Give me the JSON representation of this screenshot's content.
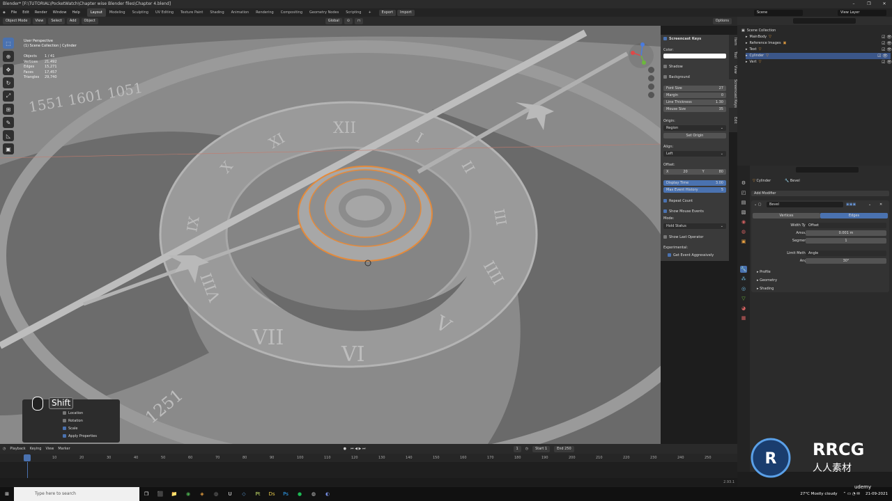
{
  "window": {
    "title": "Blender* [F:\\TUTORIAL\\PocketWatch\\Chapter wise Blender files\\Chapter 4.blend]",
    "controls": [
      "–",
      "❐",
      "✕"
    ]
  },
  "menubar": {
    "menus": [
      "File",
      "Edit",
      "Render",
      "Window",
      "Help"
    ],
    "workspaces": [
      "Layout",
      "Modeling",
      "Sculpting",
      "UV Editing",
      "Texture Paint",
      "Shading",
      "Animation",
      "Rendering",
      "Compositing",
      "Geometry Nodes",
      "Scripting"
    ],
    "active_workspace": "Layout",
    "export_label": "Export",
    "import_label": "Import",
    "scene": "Scene",
    "view_layer": "View Layer"
  },
  "viewport_header": {
    "mode": "Object Mode",
    "menus": [
      "View",
      "Select",
      "Add",
      "Object"
    ],
    "transform_orientation": "Global",
    "options_label": "Options"
  },
  "viewport": {
    "perspective": "User Perspective",
    "collection_info": "(1) Scene Collection | Cylinder",
    "stats": [
      {
        "label": "Objects",
        "value": "1 / 41"
      },
      {
        "label": "Vertices",
        "value": "21,492"
      },
      {
        "label": "Edges",
        "value": "15,271"
      },
      {
        "label": "Faces",
        "value": "17,457"
      },
      {
        "label": "Triangles",
        "value": "29,740"
      }
    ],
    "numerals": [
      "XII",
      "XI",
      "X",
      "IX",
      "VIII",
      "VII",
      "VI",
      "V",
      "IIII",
      "III",
      "II",
      "I"
    ],
    "outer_ring_text": "1551 1601 1051",
    "outer_ring_text_bottom": "1251"
  },
  "screencast_keys": {
    "title": "Screencast Keys",
    "color_label": "Color:",
    "color_value": "#ffffff",
    "shadow_label": "Shadow",
    "background_label": "Background",
    "fields": [
      {
        "label": "Font Size",
        "value": "27"
      },
      {
        "label": "Margin",
        "value": "0"
      },
      {
        "label": "Line Thickness",
        "value": "1.30"
      },
      {
        "label": "Mouse Size",
        "value": "35"
      }
    ],
    "origin_label": "Origin:",
    "origin_value": "Region",
    "set_origin_label": "Set Origin",
    "align_label": "Align:",
    "align_value": "Left",
    "offset_label": "Offset:",
    "offset_x": "X",
    "offset_x_value": "20",
    "offset_y": "Y",
    "offset_y_value": "80",
    "display_time_label": "Display Time",
    "display_time_value": "3.00",
    "max_event_label": "Max Event History",
    "max_event_value": "5",
    "repeat_count_label": "Repeat Count",
    "show_mouse_label": "Show Mouse Events",
    "mode_label": "Mode:",
    "mode_value": "Hold Status",
    "show_last_op_label": "Show Last Operator",
    "experimental_label": "Experimental:",
    "get_event_label": "Get Event Aggressively"
  },
  "side_tabs": [
    "Item",
    "Tool",
    "View",
    "Screencast Keys",
    "Edit"
  ],
  "operator_panel": {
    "key": "Shift",
    "rows": [
      {
        "label": "Location",
        "checked": false
      },
      {
        "label": "Rotation",
        "checked": false
      },
      {
        "label": "Scale",
        "checked": true
      },
      {
        "label": "Apply Properties",
        "checked": true
      }
    ]
  },
  "outliner": {
    "search_placeholder": "",
    "root": "Scene Collection",
    "items": [
      {
        "name": "MainBody",
        "selected": false
      },
      {
        "name": "Reference Images",
        "selected": false
      },
      {
        "name": "Text",
        "selected": false
      },
      {
        "name": "Cylinder",
        "selected": true
      },
      {
        "name": "Vert",
        "selected": false
      }
    ]
  },
  "properties": {
    "object_name": "Cylinder",
    "modifier_breadcrumb": "Bevel",
    "add_modifier_label": "Add Modifier",
    "modifier_name": "Bevel",
    "tab_vertices": "Vertices",
    "tab_edges": "Edges",
    "width_type_label": "Width Type",
    "width_type_value": "Offset",
    "amount_label": "Amount",
    "amount_value": "0.001 m",
    "segments_label": "Segments",
    "segments_value": "1",
    "limit_method_label": "Limit Method",
    "limit_method_value": "Angle",
    "angle_label": "Angle",
    "angle_value": "30°",
    "subpanels": [
      "Profile",
      "Geometry",
      "Shading"
    ]
  },
  "timeline": {
    "menus": [
      "Playback",
      "Keying",
      "View",
      "Marker"
    ],
    "current_frame": "1",
    "start_label": "Start",
    "start_value": "1",
    "end_label": "End",
    "end_value": "250",
    "ticks": [
      "0",
      "10",
      "20",
      "30",
      "40",
      "50",
      "60",
      "70",
      "80",
      "90",
      "100",
      "110",
      "120",
      "130",
      "140",
      "150",
      "160",
      "170",
      "180",
      "190",
      "200",
      "210",
      "220",
      "230",
      "240",
      "250"
    ],
    "version": "2.93.1"
  },
  "taskbar": {
    "search_placeholder": "Type here to search",
    "weather": "27°C  Mostly cloudy",
    "time": "",
    "date": "21-09-2021",
    "app_icons": [
      "⊞",
      "❐",
      "⬛",
      "📁",
      "◉",
      "◈",
      "◎",
      "U",
      "◇",
      "Pt",
      "Ds",
      "Ps",
      "●",
      "◍",
      "◐"
    ]
  },
  "watermark": {
    "brand": "RRCG",
    "sub": "人人素材",
    "udemy": "udemy"
  }
}
